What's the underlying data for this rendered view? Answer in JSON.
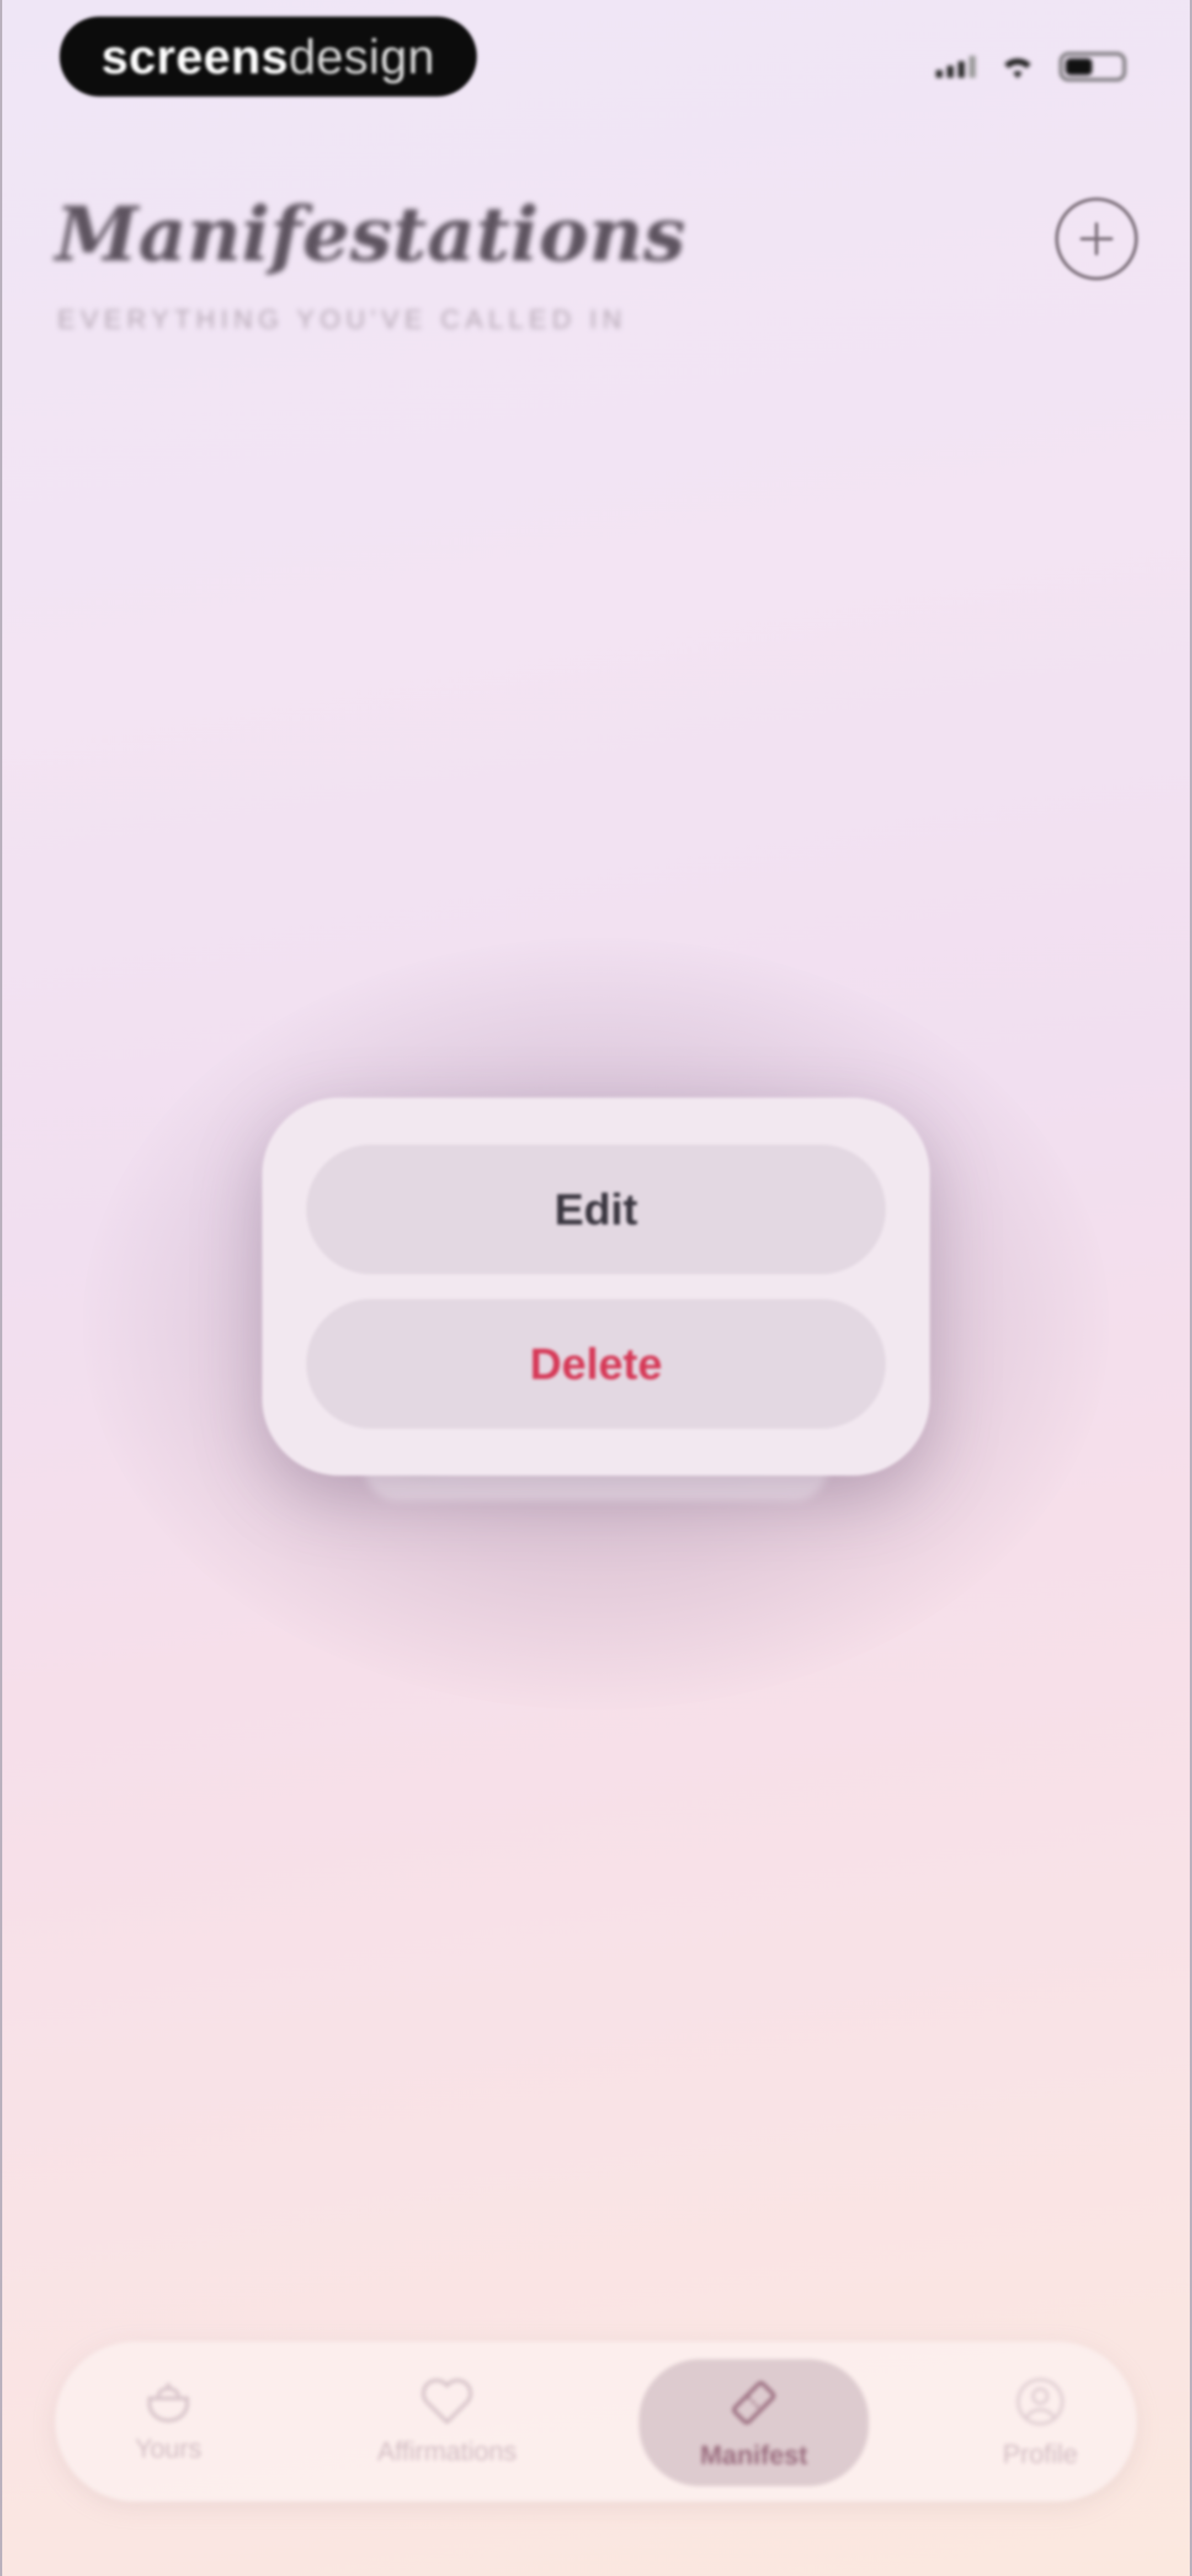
{
  "status_bar": {
    "brand_bold": "screens",
    "brand_light": "design",
    "icons": [
      "cellular-signal-icon",
      "wifi-icon",
      "battery-icon"
    ]
  },
  "header": {
    "title": "Manifestations",
    "subtitle": "EVERYTHING YOU'VE CALLED IN",
    "add_icon": "plus-circle-icon"
  },
  "context_menu": {
    "edit_label": "Edit",
    "delete_label": "Delete",
    "delete_color": "#d63957"
  },
  "tabbar": {
    "tabs": [
      {
        "label": "Yours",
        "icon": "pot-icon"
      },
      {
        "label": "Affirmations",
        "icon": "heart-icon"
      },
      {
        "label": "Manifest",
        "icon": "ticket-icon",
        "active": true
      },
      {
        "label": "Profile",
        "icon": "person-icon"
      }
    ]
  },
  "colors": {
    "title": "#5e5460",
    "subtitle": "#b3a5b2",
    "accent": "#9a6c7e"
  }
}
